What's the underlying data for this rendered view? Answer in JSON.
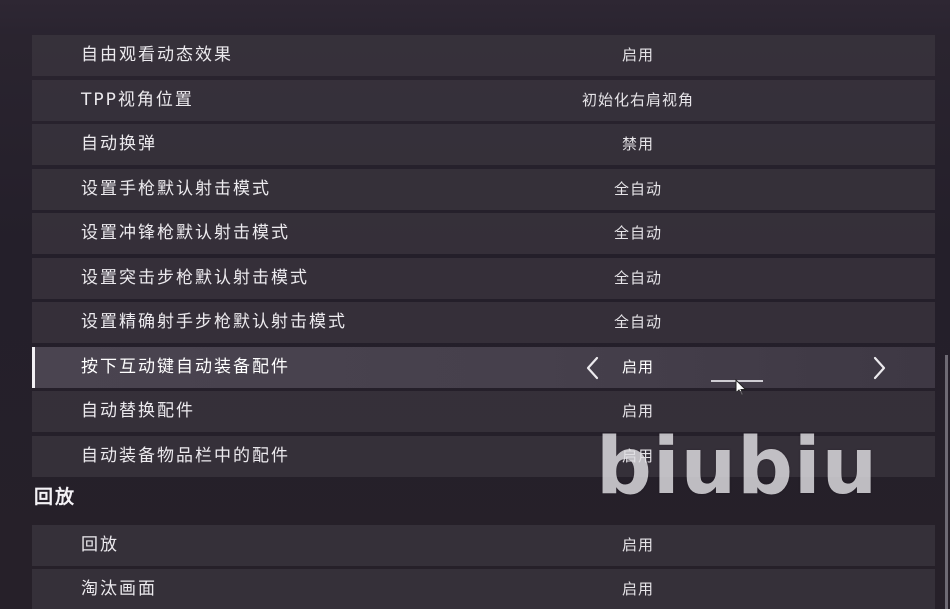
{
  "settings_group_1": {
    "rows": [
      {
        "label": "自由观看动态效果",
        "value": "启用"
      },
      {
        "label": "TPP视角位置",
        "value": "初始化右肩视角"
      },
      {
        "label": "自动换弹",
        "value": "禁用"
      },
      {
        "label": "设置手枪默认射击模式",
        "value": "全自动"
      },
      {
        "label": "设置冲锋枪默认射击模式",
        "value": "全自动"
      },
      {
        "label": "设置突击步枪默认射击模式",
        "value": "全自动"
      },
      {
        "label": "设置精确射手步枪默认射击模式",
        "value": "全自动"
      },
      {
        "label": "按下互动键自动装备配件",
        "value": "启用"
      },
      {
        "label": "自动替换配件",
        "value": "启用"
      },
      {
        "label": "自动装备物品栏中的配件",
        "value": "启用"
      }
    ],
    "selected_index": 7
  },
  "replay_section": {
    "title": "回放",
    "rows": [
      {
        "label": "回放",
        "value": "启用"
      },
      {
        "label": "淘汰画面",
        "value": "启用"
      }
    ]
  },
  "watermark": {
    "text": "biubiu"
  },
  "icons": {
    "prev": "chevron-left-icon",
    "next": "chevron-right-icon",
    "cursor": "mouse-pointer-icon"
  },
  "colors": {
    "background": "#262029",
    "row": "#3a343e",
    "selected_row": "#4a4450",
    "accent": "#f2f0f4"
  }
}
